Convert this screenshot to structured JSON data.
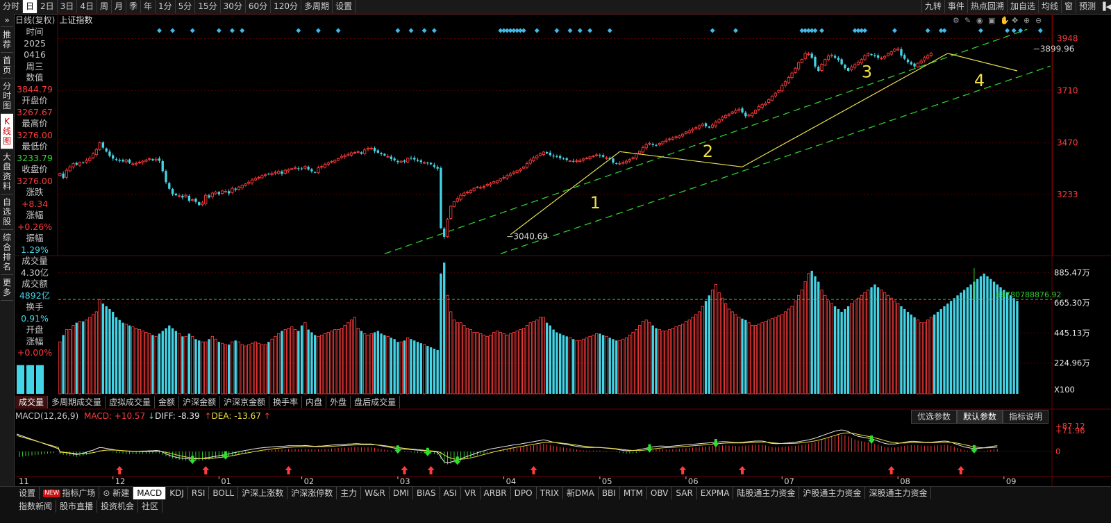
{
  "toolbar": {
    "period_tabs": [
      "分时",
      "日",
      "2日",
      "3日",
      "4日",
      "周",
      "月",
      "季",
      "年",
      "1分",
      "5分",
      "15分",
      "30分",
      "60分",
      "120分",
      "多周期",
      "设置"
    ],
    "right_tools": [
      "九转",
      "事件",
      "热点回溯",
      "加自选",
      "均线",
      "窗",
      "预测"
    ]
  },
  "left_nav": [
    "推荐",
    "首页",
    "分时图",
    "K线图",
    "大盘资料",
    "自选股",
    "综合排名",
    "更多"
  ],
  "chart": {
    "adjust_label": "日线(复权)",
    "index_name": "上证指数"
  },
  "info_panel": [
    {
      "text": "时间",
      "cls": ""
    },
    {
      "text": "2025",
      "cls": ""
    },
    {
      "text": "0416",
      "cls": ""
    },
    {
      "text": "周三",
      "cls": ""
    },
    {
      "text": "数值",
      "cls": ""
    },
    {
      "text": "3844.79",
      "cls": "red"
    },
    {
      "text": "开盘价",
      "cls": ""
    },
    {
      "text": "3267.67",
      "cls": "red"
    },
    {
      "text": "最高价",
      "cls": ""
    },
    {
      "text": "3276.00",
      "cls": "red"
    },
    {
      "text": "最低价",
      "cls": ""
    },
    {
      "text": "3233.79",
      "cls": "green"
    },
    {
      "text": "收盘价",
      "cls": ""
    },
    {
      "text": "3276.00",
      "cls": "red"
    },
    {
      "text": "涨跌",
      "cls": ""
    },
    {
      "text": "+8.34",
      "cls": "red"
    },
    {
      "text": "涨幅",
      "cls": ""
    },
    {
      "text": "+0.26%",
      "cls": "red"
    },
    {
      "text": "振幅",
      "cls": ""
    },
    {
      "text": "1.29%",
      "cls": "cyan"
    },
    {
      "text": "成交量",
      "cls": ""
    },
    {
      "text": "4.30亿",
      "cls": ""
    },
    {
      "text": "成交额",
      "cls": ""
    },
    {
      "text": "4892亿",
      "cls": "cyan"
    },
    {
      "text": "换手",
      "cls": ""
    },
    {
      "text": "0.91%",
      "cls": "cyan"
    },
    {
      "text": "开盘",
      "cls": ""
    },
    {
      "text": "涨幅",
      "cls": ""
    },
    {
      "text": "+0.00%",
      "cls": "red"
    }
  ],
  "volume_tabs": [
    "成交量",
    "多周期成交量",
    "虚拟成交量",
    "金额",
    "沪深金额",
    "沪深京金额",
    "换手率",
    "内盘",
    "外盘",
    "盘后成交量"
  ],
  "macd": {
    "label": "MACD(12,26,9)",
    "macd_text": "MACD: +10.57",
    "diff_text": "DIFF: -8.39",
    "dea_text": "DEA: -13.67",
    "param_buttons": [
      "优选参数",
      "默认参数",
      "指标说明"
    ]
  },
  "indicator_tabs": [
    "设置",
    "指标广场",
    "新建",
    "MACD",
    "KDJ",
    "RSI",
    "BOLL",
    "沪深上涨数",
    "沪深涨停数",
    "主力",
    "W&R",
    "DMI",
    "BIAS",
    "ASI",
    "VR",
    "ARBR",
    "DPO",
    "TRIX",
    "新DMA",
    "BBI",
    "MTM",
    "OBV",
    "SAR",
    "EXPMA",
    "陆股通主力资金",
    "沪股通主力资金",
    "深股通主力资金"
  ],
  "new_badge": "NEW",
  "news_tabs": [
    "指数新闻",
    "股市直播",
    "投资机会",
    "社区"
  ],
  "chart_data": {
    "type": "candlestick",
    "price_axis_ticks": [
      "3948",
      "3710",
      "3470",
      "3233"
    ],
    "price_ylim": [
      2960,
      4010
    ],
    "volume_axis_ticks": [
      "885.47万",
      "665.30万",
      "445.13万",
      "224.96万"
    ],
    "volume_unit": "X100",
    "volume_ylim": [
      0,
      950
    ],
    "volume_ref_line": 68780788876.92,
    "volume_ref_label": "68780788876.92",
    "macd_axis_ticks": [
      "+87.12",
      "+71.96",
      "0"
    ],
    "macd_ylim": [
      -80,
      100
    ],
    "x_month_labels": [
      {
        "label": "11",
        "i": 0
      },
      {
        "label": "12",
        "i": 16
      },
      {
        "label": "01",
        "i": 48
      },
      {
        "label": "02",
        "i": 73
      },
      {
        "label": "03",
        "i": 102
      },
      {
        "label": "04",
        "i": 134
      },
      {
        "label": "05",
        "i": 163
      },
      {
        "label": "06",
        "i": 189
      },
      {
        "label": "07",
        "i": 218
      },
      {
        "label": "08",
        "i": 253
      },
      {
        "label": "09",
        "i": 285
      }
    ],
    "annotations": [
      {
        "text": "3040.69",
        "i": 135,
        "price": 3040.69
      },
      {
        "text": "3899.96",
        "i": 294,
        "price": 3899.96
      },
      {
        "text": "1",
        "i": 160,
        "price": 3170
      },
      {
        "text": "2",
        "i": 194,
        "price": 3405
      },
      {
        "text": "3",
        "i": 242,
        "price": 3770
      },
      {
        "text": "4",
        "i": 276,
        "price": 3730
      }
    ],
    "n": 300,
    "close": [
      3330,
      3310,
      3345,
      3360,
      3375,
      3370,
      3380,
      3378,
      3390,
      3400,
      3420,
      3440,
      3470,
      3448,
      3430,
      3410,
      3398,
      3392,
      3388,
      3385,
      3392,
      3378,
      3374,
      3376,
      3382,
      3386,
      3392,
      3398,
      3390,
      3395,
      3388,
      3340,
      3290,
      3260,
      3235,
      3230,
      3228,
      3220,
      3230,
      3205,
      3210,
      3200,
      3185,
      3195,
      3230,
      3220,
      3240,
      3245,
      3235,
      3250,
      3248,
      3238,
      3262,
      3255,
      3268,
      3275,
      3282,
      3290,
      3300,
      3308,
      3312,
      3320,
      3325,
      3326,
      3330,
      3335,
      3340,
      3328,
      3345,
      3348,
      3352,
      3356,
      3352,
      3350,
      3362,
      3348,
      3340,
      3334,
      3356,
      3362,
      3372,
      3378,
      3385,
      3390,
      3398,
      3408,
      3412,
      3418,
      3424,
      3426,
      3430,
      3420,
      3438,
      3445,
      3446,
      3432,
      3425,
      3418,
      3412,
      3408,
      3396,
      3390,
      3382,
      3386,
      3384,
      3400,
      3398,
      3394,
      3388,
      3382,
      3380,
      3376,
      3372,
      3360,
      3352,
      3080,
      3040,
      3120,
      3180,
      3200,
      3215,
      3230,
      3240,
      3245,
      3252,
      3262,
      3268,
      3266,
      3270,
      3280,
      3284,
      3292,
      3296,
      3306,
      3312,
      3320,
      3328,
      3336,
      3342,
      3350,
      3360,
      3375,
      3392,
      3402,
      3410,
      3420,
      3428,
      3422,
      3414,
      3408,
      3406,
      3400,
      3398,
      3392,
      3388,
      3385,
      3388,
      3390,
      3396,
      3400,
      3406,
      3410,
      3415,
      3412,
      3406,
      3402,
      3396,
      3380,
      3374,
      3376,
      3380,
      3386,
      3394,
      3402,
      3420,
      3432,
      3448,
      3462,
      3468,
      3460,
      3458,
      3468,
      3476,
      3482,
      3488,
      3492,
      3498,
      3502,
      3510,
      3520,
      3526,
      3532,
      3540,
      3548,
      3556,
      3546,
      3540,
      3552,
      3565,
      3576,
      3588,
      3596,
      3602,
      3612,
      3618,
      3624,
      3610,
      3592,
      3598,
      3606,
      3620,
      3636,
      3645,
      3652,
      3668,
      3684,
      3698,
      3710,
      3732,
      3750,
      3770,
      3790,
      3812,
      3838,
      3852,
      3880,
      3878,
      3860,
      3820,
      3800,
      3830,
      3852,
      3868,
      3872,
      3860,
      3850,
      3830,
      3812,
      3800,
      3818,
      3828,
      3840,
      3852,
      3870,
      3880,
      3872,
      3868,
      3860,
      3858,
      3866,
      3878,
      3888,
      3900,
      3899.96,
      3870,
      3855,
      3840,
      3830,
      3820,
      3835,
      3845,
      3860,
      3870,
      3880
    ],
    "volume": [
      380,
      430,
      470,
      470,
      500,
      520,
      530,
      530,
      540,
      560,
      580,
      600,
      690,
      660,
      640,
      620,
      600,
      560,
      540,
      520,
      510,
      500,
      490,
      480,
      470,
      460,
      450,
      440,
      430,
      420,
      440,
      460,
      480,
      500,
      480,
      460,
      440,
      420,
      420,
      440,
      420,
      400,
      390,
      380,
      380,
      400,
      420,
      400,
      380,
      370,
      360,
      360,
      380,
      390,
      380,
      360,
      350,
      360,
      370,
      380,
      370,
      360,
      360,
      380,
      400,
      420,
      440,
      460,
      470,
      480,
      490,
      470,
      460,
      500,
      520,
      470,
      450,
      430,
      420,
      430,
      440,
      450,
      460,
      470,
      470,
      480,
      500,
      520,
      540,
      560,
      480,
      460,
      440,
      430,
      440,
      450,
      460,
      440,
      430,
      420,
      410,
      400,
      380,
      380,
      390,
      410,
      400,
      390,
      380,
      370,
      360,
      350,
      340,
      330,
      320,
      880,
      960,
      720,
      600,
      540,
      520,
      520,
      500,
      480,
      470,
      450,
      450,
      440,
      430,
      420,
      430,
      450,
      460,
      450,
      440,
      430,
      440,
      450,
      460,
      470,
      480,
      500,
      520,
      530,
      540,
      560,
      560,
      520,
      500,
      470,
      450,
      440,
      430,
      420,
      410,
      400,
      390,
      390,
      400,
      410,
      420,
      430,
      440,
      440,
      430,
      420,
      410,
      400,
      390,
      390,
      400,
      410,
      430,
      450,
      470,
      500,
      530,
      540,
      520,
      500,
      480,
      470,
      460,
      460,
      470,
      480,
      490,
      500,
      510,
      530,
      540,
      560,
      580,
      600,
      640,
      680,
      720,
      760,
      800,
      740,
      700,
      660,
      620,
      600,
      580,
      560,
      550,
      540,
      520,
      500,
      500,
      510,
      520,
      530,
      540,
      550,
      560,
      570,
      580,
      600,
      620,
      640,
      680,
      720,
      760,
      820,
      880,
      900,
      860,
      820,
      760,
      720,
      680,
      660,
      640,
      620,
      600,
      620,
      640,
      660,
      680,
      700,
      720,
      740,
      760,
      780,
      800,
      780,
      760,
      740,
      720,
      700,
      680,
      660,
      640,
      620,
      600,
      580,
      560,
      540,
      520,
      520,
      540,
      560,
      580,
      600,
      620,
      640,
      660,
      680,
      700,
      720,
      740,
      760,
      780,
      800,
      820,
      840,
      860,
      880,
      860,
      840,
      820,
      800,
      780,
      760,
      740,
      720,
      700,
      680
    ],
    "macd": [
      -10,
      -12,
      -14,
      -16,
      -18,
      -20,
      -18,
      -15,
      -12,
      -8,
      -5,
      0,
      4,
      3,
      1,
      -1,
      -3,
      -5,
      -6,
      -7,
      -8,
      -9,
      -9,
      -9,
      -9,
      -8,
      -8,
      -7,
      -7,
      -6,
      -7,
      -12,
      -18,
      -22,
      -26,
      -29,
      -31,
      -33,
      -34,
      -35,
      -35,
      -35,
      -34,
      -33,
      -31,
      -30,
      -28,
      -26,
      -24,
      -22,
      -20,
      -18,
      -15,
      -13,
      -10,
      -8,
      -6,
      -4,
      -2,
      0,
      2,
      3,
      4,
      5,
      6,
      7,
      8,
      8,
      9,
      10,
      10,
      10,
      10,
      10,
      11,
      10,
      9,
      8,
      9,
      9,
      10,
      11,
      12,
      13,
      14,
      15,
      15,
      16,
      16,
      17,
      17,
      16,
      16,
      16,
      16,
      14,
      12,
      10,
      8,
      6,
      4,
      2,
      0,
      -1,
      -2,
      -2,
      -3,
      -4,
      -5,
      -6,
      -7,
      -8,
      -9,
      -10,
      -12,
      -28,
      -45,
      -48,
      -46,
      -42,
      -38,
      -34,
      -30,
      -26,
      -22,
      -18,
      -14,
      -10,
      -7,
      -4,
      -1,
      1,
      3,
      5,
      7,
      9,
      11,
      13,
      14,
      16,
      18,
      20,
      22,
      24,
      26,
      28,
      30,
      28,
      25,
      22,
      20,
      18,
      16,
      14,
      12,
      10,
      8,
      6,
      5,
      4,
      4,
      4,
      4,
      4,
      3,
      2,
      1,
      0,
      -2,
      -4,
      -6,
      -7,
      -7,
      -6,
      -5,
      -3,
      -1,
      2,
      4,
      6,
      8,
      9,
      9,
      8,
      8,
      9,
      10,
      11,
      12,
      13,
      14,
      15,
      16,
      17,
      18,
      19,
      20,
      21,
      22,
      23,
      24,
      24,
      23,
      22,
      21,
      21,
      22,
      23,
      24,
      25,
      26,
      26,
      26,
      24,
      20,
      18,
      17,
      17,
      18,
      19,
      20,
      21,
      22,
      24,
      26,
      28,
      30,
      33,
      36,
      40,
      44,
      48,
      52,
      56,
      60,
      62,
      64,
      62,
      58,
      52,
      46,
      42,
      40,
      38,
      36,
      34,
      30,
      26,
      22,
      18,
      16,
      16,
      16,
      18,
      20,
      22,
      24,
      25,
      25,
      24,
      23,
      22,
      22,
      22,
      23,
      24,
      25,
      26,
      25,
      22,
      18,
      14,
      10,
      6,
      4,
      2,
      1,
      1,
      2,
      3,
      5,
      7,
      9,
      10
    ],
    "signals": [
      {
        "i": 18,
        "type": "buy"
      },
      {
        "i": 40,
        "type": "sell"
      },
      {
        "i": 50,
        "type": "sell"
      },
      {
        "i": 44,
        "type": "buy"
      },
      {
        "i": 69,
        "type": "buy"
      },
      {
        "i": 102,
        "type": "sell"
      },
      {
        "i": 111,
        "type": "sell"
      },
      {
        "i": 104,
        "type": "buy"
      },
      {
        "i": 112,
        "type": "buy"
      },
      {
        "i": 120,
        "type": "sell"
      },
      {
        "i": 143,
        "type": "buy"
      },
      {
        "i": 178,
        "type": "sell"
      },
      {
        "i": 188,
        "type": "buy"
      },
      {
        "i": 198,
        "type": "sell"
      },
      {
        "i": 206,
        "type": "buy"
      },
      {
        "i": 245,
        "type": "sell"
      },
      {
        "i": 251,
        "type": "buy"
      },
      {
        "i": 272,
        "type": "buy"
      },
      {
        "i": 276,
        "type": "sell"
      }
    ],
    "diamonds": [
      30,
      34,
      40,
      48,
      52,
      55,
      72,
      78,
      84,
      102,
      106,
      110,
      113,
      133,
      134,
      135,
      136,
      137,
      138,
      139,
      140,
      144,
      150,
      154,
      157,
      160,
      166,
      197,
      204,
      224,
      225,
      226,
      227,
      228,
      230,
      240,
      241,
      242,
      243,
      252,
      262,
      266,
      267,
      278,
      286,
      288,
      290,
      296
    ]
  }
}
